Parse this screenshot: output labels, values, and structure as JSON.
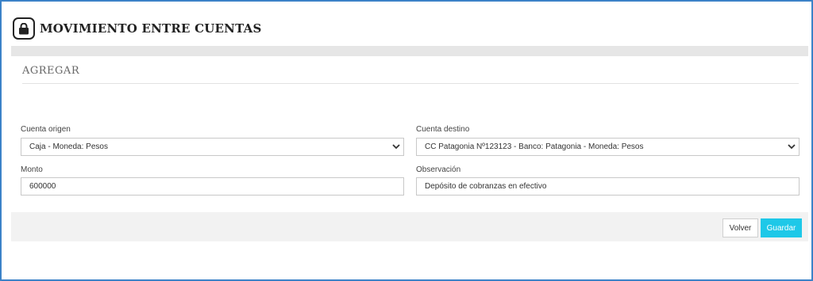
{
  "header": {
    "title": "MOVIMIENTO ENTRE CUENTAS",
    "icon": "lock-icon"
  },
  "panel": {
    "title": "AGREGAR"
  },
  "form": {
    "origin_label": "Cuenta origen",
    "origin_value": "Caja - Moneda: Pesos",
    "destination_label": "Cuenta destino",
    "destination_value": "CC Patagonia Nº123123 - Banco: Patagonia - Moneda: Pesos",
    "amount_label": "Monto",
    "amount_value": "600000",
    "note_label": "Observación",
    "note_value": "Depósito de cobranzas en efectivo"
  },
  "actions": {
    "back_label": "Volver",
    "save_label": "Guardar"
  },
  "colors": {
    "accent": "#1ec8e8",
    "frame": "#3b82c8"
  }
}
